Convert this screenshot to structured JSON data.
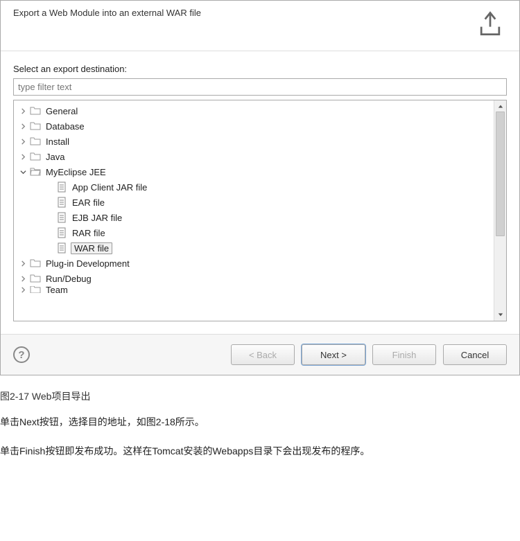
{
  "header": {
    "subtitle": "Export a Web Module into an external WAR file"
  },
  "body": {
    "label": "Select an export destination:",
    "filter_placeholder": "type filter text"
  },
  "tree": {
    "items": [
      {
        "label": "General",
        "expanded": false,
        "level": 0,
        "icon": "folder"
      },
      {
        "label": "Database",
        "expanded": false,
        "level": 0,
        "icon": "folder"
      },
      {
        "label": "Install",
        "expanded": false,
        "level": 0,
        "icon": "folder"
      },
      {
        "label": "Java",
        "expanded": false,
        "level": 0,
        "icon": "folder"
      },
      {
        "label": "MyEclipse JEE",
        "expanded": true,
        "level": 0,
        "icon": "folder-open"
      },
      {
        "label": "App Client JAR file",
        "expanded": null,
        "level": 1,
        "icon": "appclient"
      },
      {
        "label": "EAR file",
        "expanded": null,
        "level": 1,
        "icon": "ear"
      },
      {
        "label": "EJB JAR file",
        "expanded": null,
        "level": 1,
        "icon": "ejb"
      },
      {
        "label": "RAR file",
        "expanded": null,
        "level": 1,
        "icon": "rar"
      },
      {
        "label": "WAR file",
        "expanded": null,
        "level": 1,
        "icon": "war",
        "selected": true
      },
      {
        "label": "Plug-in Development",
        "expanded": false,
        "level": 0,
        "icon": "folder"
      },
      {
        "label": "Run/Debug",
        "expanded": false,
        "level": 0,
        "icon": "folder"
      },
      {
        "label": "Team",
        "expanded": false,
        "level": 0,
        "icon": "folder",
        "clipped": true
      }
    ]
  },
  "buttons": {
    "back": "< Back",
    "next": "Next >",
    "finish": "Finish",
    "cancel": "Cancel",
    "help": "?"
  },
  "caption": "图2-17    Web项目导出",
  "para1": "单击Next按钮，选择目的地址，如图2-18所示。",
  "para2": "单击Finish按钮即发布成功。这样在Tomcat安装的Webapps目录下会出现发布的程序。"
}
